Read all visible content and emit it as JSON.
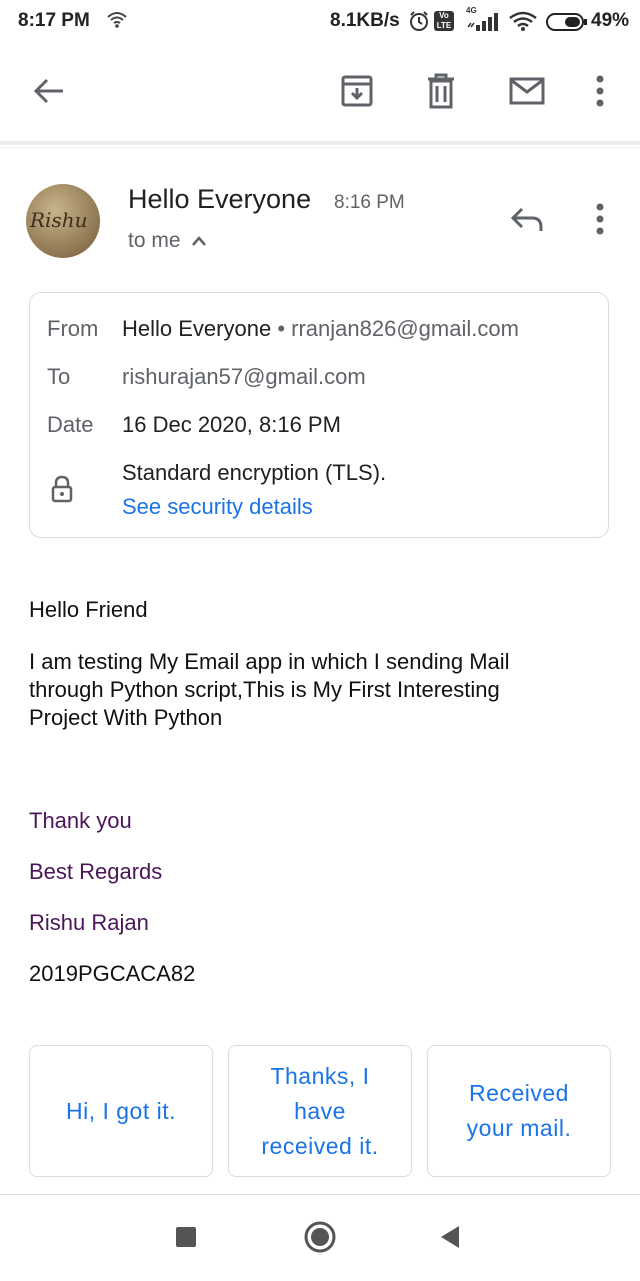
{
  "status_bar": {
    "time": "8:17 PM",
    "net_speed": "8.1KB/s",
    "network_label": "4G",
    "battery": "49%"
  },
  "toolbar": {
    "back_icon": "arrow-left-icon",
    "archive_icon": "archive-icon",
    "delete_icon": "trash-icon",
    "mark_unread_icon": "mail-icon",
    "more_icon": "more-vert-icon"
  },
  "email": {
    "avatar_text": "Rishu",
    "subject": "Hello Everyone",
    "time": "8:16 PM",
    "recipient_summary": "to me",
    "details": {
      "from_label": "From",
      "from_name": "Hello Everyone",
      "from_separator": "•",
      "from_email": "rranjan826@gmail.com",
      "to_label": "To",
      "to_email": "rishurajan57@gmail.com",
      "date_label": "Date",
      "date_value": "16 Dec 2020, 8:16 PM",
      "encryption": "Standard encryption (TLS).",
      "security_link": "See security details"
    },
    "body": {
      "greeting": "Hello Friend",
      "line1": "I am testing My Email app in which I sending Mail",
      "line2": "through Python script,This is My First Interesting",
      "line3": "Project With Python",
      "thanks": "Thank you",
      "regards": "Best Regards",
      "name": "Rishu Rajan",
      "code": "2019PGCACA82"
    }
  },
  "smart_replies": [
    {
      "line1": "Hi, I got it."
    },
    {
      "line1": "Thanks, I",
      "line2": "have",
      "line3": "received it."
    },
    {
      "line1": "Received",
      "line2": "your mail."
    }
  ],
  "colors": {
    "link": "#1a73e8",
    "signature": "#4a1657"
  }
}
